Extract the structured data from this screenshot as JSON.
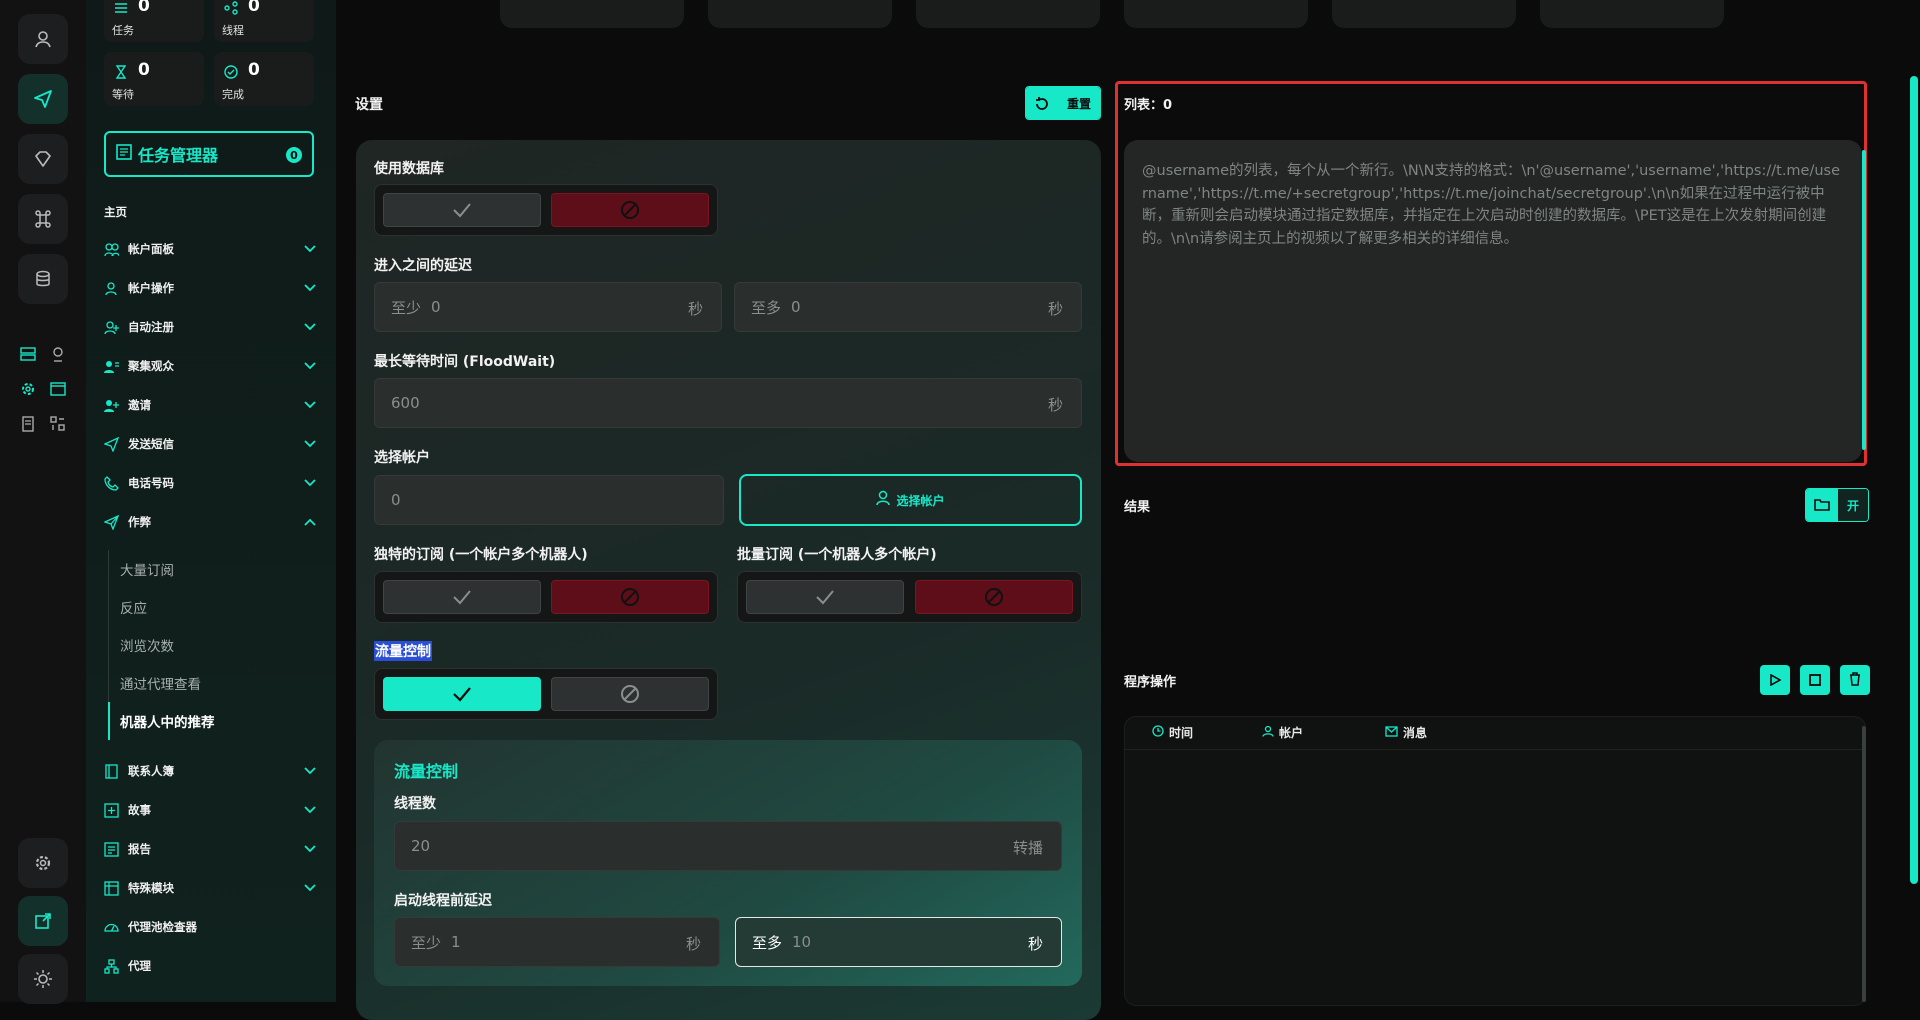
{
  "stats": {
    "tasks": {
      "value": "0",
      "label": "任务"
    },
    "threads": {
      "value": "0",
      "label": "线程"
    },
    "waiting": {
      "value": "0",
      "label": "等待"
    },
    "done": {
      "value": "0",
      "label": "完成"
    }
  },
  "task_manager": {
    "label": "任务管理器",
    "count": "0"
  },
  "nav": {
    "section": "主页",
    "items": [
      {
        "label": "帐户面板"
      },
      {
        "label": "帐户操作"
      },
      {
        "label": "自动注册"
      },
      {
        "label": "聚集观众"
      },
      {
        "label": "邀请"
      },
      {
        "label": "发送短信"
      },
      {
        "label": "电话号码"
      },
      {
        "label": "作弊"
      }
    ],
    "sub_items": [
      {
        "label": "大量订阅"
      },
      {
        "label": "反应"
      },
      {
        "label": "浏览次数"
      },
      {
        "label": "通过代理查看"
      },
      {
        "label": "机器人中的推荐"
      }
    ],
    "items2": [
      {
        "label": "联系人簿"
      },
      {
        "label": "故事"
      },
      {
        "label": "报告"
      },
      {
        "label": "特殊模块"
      },
      {
        "label": "代理池检查器"
      },
      {
        "label": "代理"
      }
    ]
  },
  "settings": {
    "title": "设置",
    "reset_label": "重置",
    "use_db_label": "使用数据库",
    "delay_label": "进入之间的延迟",
    "delay_min_prefix": "至少",
    "delay_min_value": "0",
    "delay_max_prefix": "至多",
    "delay_max_value": "0",
    "sec": "秒",
    "floodwait_label": "最长等待时间 (FloodWait)",
    "floodwait_value": "600",
    "select_accounts_label": "选择帐户",
    "select_accounts_value": "0",
    "select_accounts_button": "选择帐户",
    "unique_sub_label": "独特的订阅 (一个帐户多个机器人)",
    "bulk_sub_label": "批量订阅 (一个机器人多个帐户)",
    "flow_control_label": "流量控制",
    "flow_panel_title": "流量控制",
    "threads_label": "线程数",
    "threads_value": "20",
    "threads_suffix": "转播",
    "thread_delay_label": "启动线程前延迟",
    "thread_delay_min_value": "1",
    "thread_delay_max_value": "10"
  },
  "list": {
    "title": "列表：0",
    "placeholder": "@username的列表，每个从一个新行。\\N\\N支持的格式：\\n'@username','username','https://t.me/username','https://t.me/+secretgroup','https://t.me/joinchat/secretgroup'.\\n\\n如果在过程中运行被中断，重新则会启动模块通过指定数据库，并指定在上次启动时创建的数据库。\\PET这是在上次发射期间创建的。\\n\\n请参阅主页上的视频以了解更多相关的详细信息。"
  },
  "results": {
    "title": "结果",
    "open_label": "开"
  },
  "program_ops": {
    "title": "程序操作",
    "columns": [
      "时间",
      "帐户",
      "消息"
    ]
  },
  "colors": {
    "accent": "#16e8c8",
    "danger": "#5e0e18",
    "highlight_border": "#e03131"
  }
}
